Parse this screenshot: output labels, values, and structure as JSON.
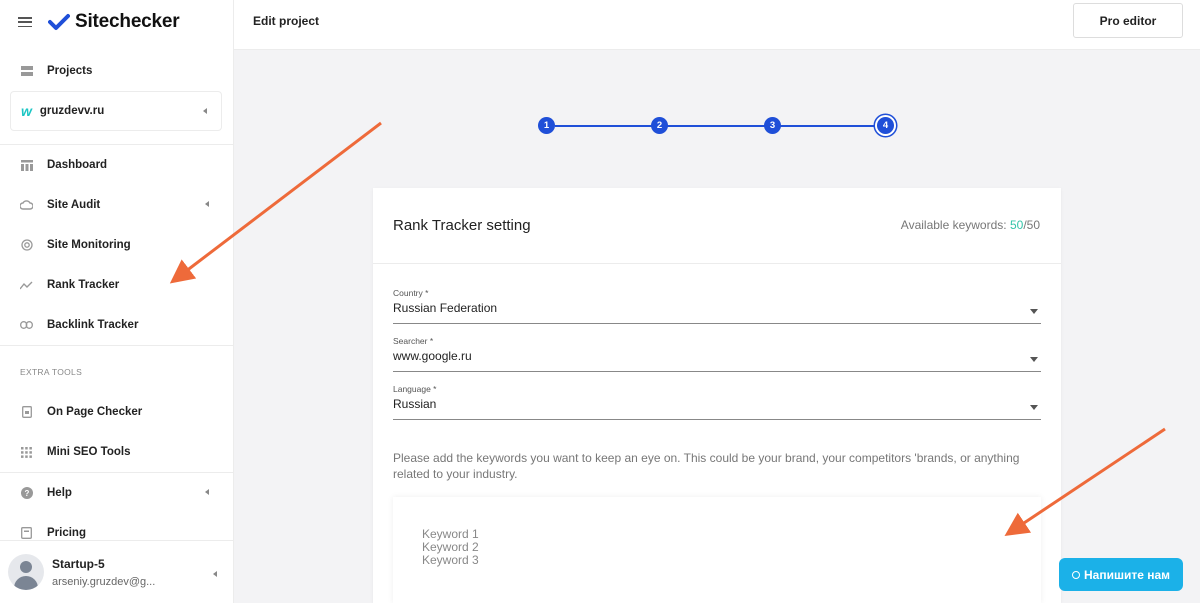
{
  "app": {
    "logo_text": "Sitechecker"
  },
  "sidebar": {
    "projects_label": "Projects",
    "project_name": "gruzdevv.ru",
    "items": [
      {
        "label": "Dashboard"
      },
      {
        "label": "Site Audit"
      },
      {
        "label": "Site Monitoring"
      },
      {
        "label": "Rank Tracker"
      },
      {
        "label": "Backlink Tracker"
      }
    ],
    "extra_tools_label": "EXTRA TOOLS",
    "extra_items": [
      {
        "label": "On Page Checker"
      },
      {
        "label": "Mini SEO Tools"
      }
    ],
    "bottom_items": [
      {
        "label": "Help"
      },
      {
        "label": "Pricing"
      }
    ],
    "user": {
      "plan": "Startup-5",
      "email": "arseniy.gruzdev@g..."
    }
  },
  "header": {
    "title": "Edit project",
    "pro_button": "Pro editor"
  },
  "stepper": {
    "steps": [
      "1",
      "2",
      "3",
      "4"
    ],
    "active_step": 4
  },
  "card": {
    "title": "Rank Tracker setting",
    "available_label": "Available keywords: ",
    "available_used": "50",
    "available_total": "/50",
    "country": {
      "label": "Country *",
      "value": "Russian Federation"
    },
    "searcher": {
      "label": "Searcher *",
      "value": "www.google.ru"
    },
    "language": {
      "label": "Language *",
      "value": "Russian"
    },
    "helper_text": "Please add the keywords you want to keep an eye on. This could be your brand, your competitors 'brands, or anything related to your industry.",
    "keywords_placeholder": [
      "Keyword 1",
      "Keyword 2",
      "Keyword 3"
    ]
  },
  "chat": {
    "label": "Напишите нам"
  },
  "colors": {
    "accent": "#1f4fd8",
    "teal": "#33c4a8",
    "arrow": "#ee6a3a",
    "chat": "#1bb1e8"
  }
}
